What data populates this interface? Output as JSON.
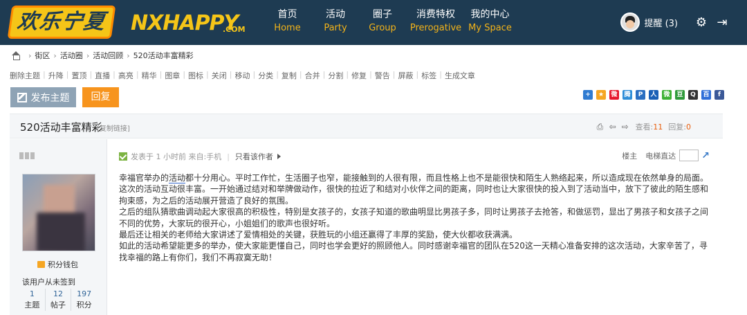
{
  "logo": {
    "cn": "欢乐宁夏",
    "en": "NXHAPPY",
    "suffix": ".COM"
  },
  "nav": [
    {
      "cn": "首页",
      "en": "Home"
    },
    {
      "cn": "活动",
      "en": "Party"
    },
    {
      "cn": "圈子",
      "en": "Group"
    },
    {
      "cn": "消费特权",
      "en": "Prerogative"
    },
    {
      "cn": "我的中心",
      "en": "My Space"
    }
  ],
  "user": {
    "remind": "提醒 (3)"
  },
  "breadcrumb": [
    "街区",
    "活动圈",
    "活动回顾",
    "520活动丰富精彩"
  ],
  "admin_tools": [
    "删除主题",
    "升降",
    "置顶",
    "直播",
    "高亮",
    "精华",
    "图章",
    "图标",
    "关闭",
    "移动",
    "分类",
    "复制",
    "合并",
    "分割",
    "修复",
    "警告",
    "屏蔽",
    "标签",
    "生成文章"
  ],
  "buttons": {
    "post": "发布主题",
    "reply": "回复"
  },
  "share": [
    {
      "name": "plus-share-icon",
      "color": "#2f7bd1",
      "glyph": "+"
    },
    {
      "name": "qzone-share-icon",
      "color": "#f5a623",
      "glyph": "★"
    },
    {
      "name": "weibo-share-icon",
      "color": "#e6162d",
      "glyph": "微"
    },
    {
      "name": "tencent-weibo-share-icon",
      "color": "#2f8ed8",
      "glyph": "腾"
    },
    {
      "name": "pengyou-share-icon",
      "color": "#2b6fc2",
      "glyph": "P"
    },
    {
      "name": "renren-share-icon",
      "color": "#1b5fb6",
      "glyph": "人"
    },
    {
      "name": "wechat-share-icon",
      "color": "#3eb135",
      "glyph": "微"
    },
    {
      "name": "douban-share-icon",
      "color": "#2f9a3a",
      "glyph": "豆"
    },
    {
      "name": "qq-share-icon",
      "color": "#333333",
      "glyph": "Q"
    },
    {
      "name": "baidu-share-icon",
      "color": "#2f6fd8",
      "glyph": "百"
    },
    {
      "name": "facebook-share-icon",
      "color": "#3b5998",
      "glyph": "f"
    }
  ],
  "thread": {
    "title": "520活动丰富精彩",
    "copy_link": "[复制链接]",
    "views_label": "查看:",
    "views": "11",
    "replies_label": "回复:",
    "replies": "0"
  },
  "poster": {
    "wallet": "积分钱包",
    "signin": "该用户从未签到",
    "stats": [
      {
        "value": "1",
        "label": "主题"
      },
      {
        "value": "12",
        "label": "帖子"
      },
      {
        "value": "197",
        "label": "积分"
      }
    ]
  },
  "post": {
    "meta": "发表于 1 小时前 来自:手机",
    "only_author": "只看该作者",
    "floor": "楼主",
    "jump_label": "电梯直达",
    "para1_pre": "幸福官举办的",
    "para1_link": "活动",
    "para1_post": "都十分用心。平时工作忙，生活圈子也窄，能接触到的人很有限，而且性格上也不是能很快和陌生人熟络起来，所以造成现在依然单身的局面。",
    "para2": "这次的活动互动很丰富。一开始通过结对和举牌做动作，很快的拉近了和结对小伙伴之间的距离，同时也让大家很快的投入到了活动当中，放下了彼此的陌生感和拘束感，为之后的活动展开营造了良好的氛围。",
    "para3": "之后的组队猜歌曲调动起大家很高的积极性，特别是女孩子的，女孩子知道的歌曲明显比男孩子多，同时让男孩子去抢答，和做惩罚，显出了男孩子和女孩子之间不同的优势，大家玩的很开心，小姐姐们的歌声也很好听。",
    "para4": "最后还让相关的老师给大家讲述了爱情相处的关键，获胜玩的小组还赢得了丰厚的奖励，使大伙都收获满满。",
    "para5": "如此的活动希望能更多的举办，使大家能更懂自己，同时也学会更好的照顾他人。同时感谢幸福官的团队在520这一天精心准备安排的这次活动，大家辛苦了，寻找幸福的路上有你们，我们不再寂寞无助！"
  }
}
